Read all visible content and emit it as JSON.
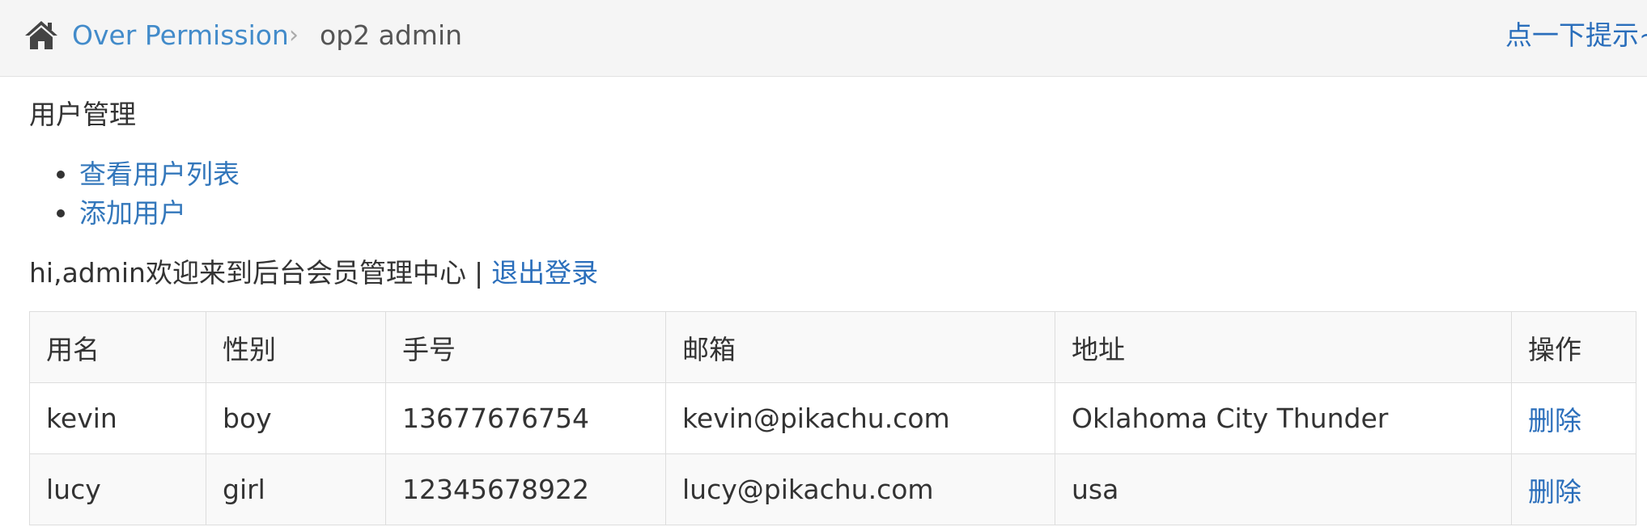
{
  "breadcrumb": {
    "home_icon": "home-icon",
    "link": "Over Permission",
    "separator": "›",
    "current": "op2 admin",
    "tip": "点一下提示~"
  },
  "section_title": "用户管理",
  "menu": {
    "items": [
      {
        "label": "查看用户列表"
      },
      {
        "label": "添加用户"
      }
    ]
  },
  "welcome": {
    "text": "hi,admin欢迎来到后台会员管理中心",
    "separator": "|",
    "logout": "退出登录"
  },
  "table": {
    "headers": [
      "用名",
      "性别",
      "手号",
      "邮箱",
      "地址",
      "操作"
    ],
    "rows": [
      {
        "username": "kevin",
        "gender": "boy",
        "phone": "13677676754",
        "email": "kevin@pikachu.com",
        "address": "Oklahoma City Thunder",
        "action": "删除"
      },
      {
        "username": "lucy",
        "gender": "girl",
        "phone": "12345678922",
        "email": "lucy@pikachu.com",
        "address": "usa",
        "action": "删除"
      }
    ]
  },
  "colors": {
    "link": "#2a6ebb",
    "breadcrumb_bg": "#f5f5f5",
    "text": "#333333",
    "border": "#dddddd"
  }
}
